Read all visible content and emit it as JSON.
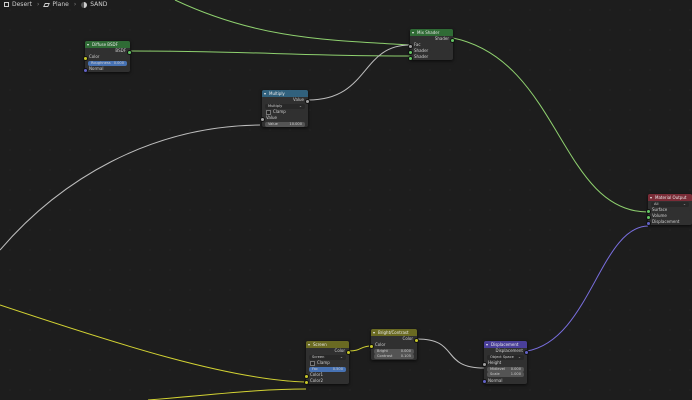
{
  "breadcrumb": {
    "item1": "Desert",
    "item2": "Plane",
    "item3": "SAND"
  },
  "nodes": {
    "diffuse": {
      "title": "Diffuse BSDF",
      "out": "BSDF",
      "in1": "Color",
      "rough_label": "Roughness",
      "rough_value": "0.000",
      "in3": "Normal"
    },
    "mix": {
      "title": "Mix Shader",
      "out": "Shader",
      "fac": "Fac",
      "in1": "Shader",
      "in2": "Shader"
    },
    "multiply": {
      "title": "Multiply",
      "out": "Value",
      "op": "Multiply",
      "clamp": "Clamp",
      "in1": "Value",
      "v_label": "Value",
      "v_value": "10.000"
    },
    "output": {
      "title": "Material Output",
      "target": "All",
      "in1": "Surface",
      "in2": "Volume",
      "in3": "Displacement"
    },
    "bc": {
      "title": "Bright/Contrast",
      "out": "Color",
      "in1": "Color",
      "b_label": "Bright",
      "b_value": "0.000",
      "c_label": "Contrast",
      "c_value": "0.105"
    },
    "screen": {
      "title": "Screen",
      "out": "Color",
      "mode": "Screen",
      "clamp": "Clamp",
      "fac_label": "Fac",
      "fac_value": "0.500",
      "in1": "Color1",
      "in2": "Color2"
    },
    "disp": {
      "title": "Displacement",
      "out": "Displacement",
      "space": "Object Space",
      "in1": "Height",
      "mid_label": "Midlevel",
      "mid_value": "0.000",
      "scale_label": "Scale",
      "scale_value": "1.000",
      "in4": "Normal"
    }
  },
  "colors": {
    "shader": "#63c763",
    "color": "#c7c729",
    "value": "#a1a1a1",
    "vector": "#6363c7"
  }
}
